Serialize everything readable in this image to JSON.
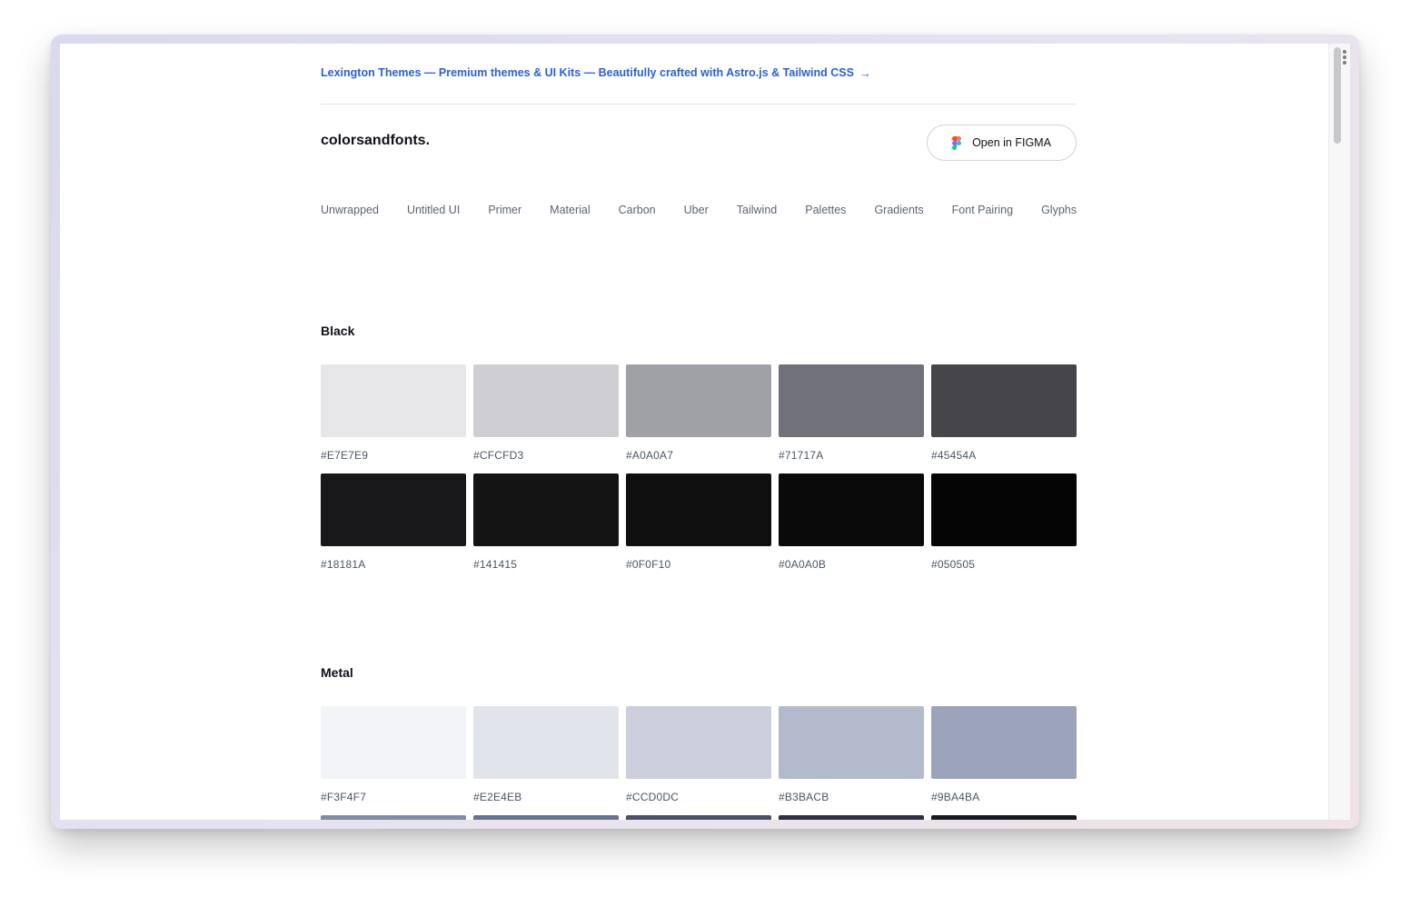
{
  "promo": {
    "text": "Lexington Themes — Premium themes & UI Kits — Beautifully crafted with Astro.js & Tailwind CSS",
    "arrow": "→"
  },
  "brand": "colorsandfonts.",
  "figma_button": {
    "label": "Open in FIGMA",
    "icon": "figma-icon"
  },
  "nav": [
    "Unwrapped",
    "Untitled UI",
    "Primer",
    "Material",
    "Carbon",
    "Uber",
    "Tailwind",
    "Palettes",
    "Gradients",
    "Font Pairing",
    "Glyphs"
  ],
  "sections": [
    {
      "title": "Black",
      "swatches": [
        {
          "hex": "#E7E7E9",
          "color": "#E7E7E9"
        },
        {
          "hex": "#CFCFD3",
          "color": "#CFCFD3"
        },
        {
          "hex": "#A0A0A7",
          "color": "#A0A0A7"
        },
        {
          "hex": "#71717A",
          "color": "#71717A"
        },
        {
          "hex": "#45454A",
          "color": "#45454A"
        },
        {
          "hex": "#18181A",
          "color": "#18181A"
        },
        {
          "hex": "#141415",
          "color": "#141415"
        },
        {
          "hex": "#0F0F10",
          "color": "#0F0F10"
        },
        {
          "hex": "#0A0A0B",
          "color": "#0A0A0B"
        },
        {
          "hex": "#050505",
          "color": "#050505"
        }
      ]
    },
    {
      "title": "Metal",
      "swatches": [
        {
          "hex": "#F3F4F7",
          "color": "#F3F4F7"
        },
        {
          "hex": "#E2E4EB",
          "color": "#E2E4EB"
        },
        {
          "hex": "#CCD0DC",
          "color": "#CCD0DC"
        },
        {
          "hex": "#B3BACB",
          "color": "#B3BACB"
        },
        {
          "hex": "#9BA4BA",
          "color": "#9BA4BA"
        }
      ],
      "next_row_colors": [
        "#828CA5",
        "#69728C",
        "#4A5068",
        "#2D3142",
        "#16181F"
      ]
    }
  ],
  "colors": {
    "link": "#2C5FD8",
    "text": "#0F1117",
    "muted": "#5B6472"
  }
}
